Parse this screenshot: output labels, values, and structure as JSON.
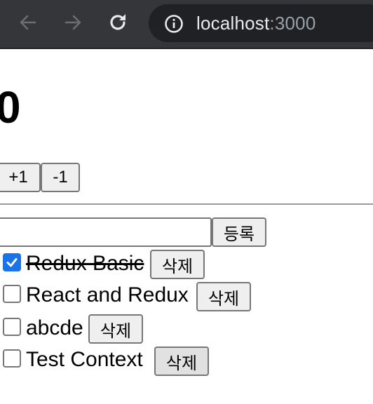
{
  "browser": {
    "url_host": "localhost",
    "url_port": ":3000"
  },
  "counter": {
    "value": "0",
    "increment_label": "+1",
    "decrement_label": "-1"
  },
  "todo_form": {
    "input_value": "",
    "submit_label": "등록"
  },
  "todos": [
    {
      "text": "Redux Basic",
      "done": true,
      "delete_label": "삭제"
    },
    {
      "text": "React and Redux",
      "done": false,
      "delete_label": "삭제"
    },
    {
      "text": "abcde",
      "done": false,
      "delete_label": "삭제"
    },
    {
      "text": "Test Context",
      "done": false,
      "delete_label": "삭제"
    }
  ],
  "colors": {
    "toolbar_bg": "#35363a",
    "omnibox_bg": "#202124",
    "checkbox_checked": "#1a73e8"
  }
}
